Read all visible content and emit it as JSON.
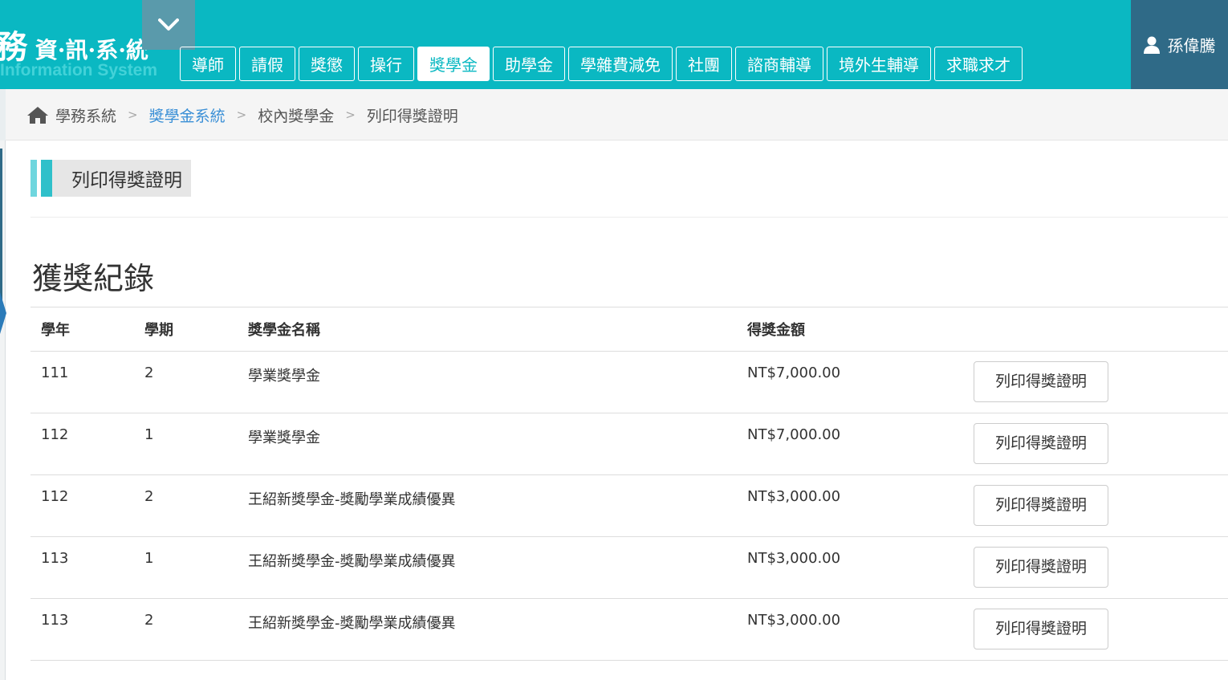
{
  "header": {
    "logo_main_big": "務",
    "logo_main_rest": " 資·訊·系·統",
    "logo_sub": "Information System",
    "nav": [
      {
        "label": "導師",
        "active": false
      },
      {
        "label": "請假",
        "active": false
      },
      {
        "label": "獎懲",
        "active": false
      },
      {
        "label": "操行",
        "active": false
      },
      {
        "label": "獎學金",
        "active": true
      },
      {
        "label": "助學金",
        "active": false
      },
      {
        "label": "學雜費減免",
        "active": false
      },
      {
        "label": "社團",
        "active": false
      },
      {
        "label": "諮商輔導",
        "active": false
      },
      {
        "label": "境外生輔導",
        "active": false
      },
      {
        "label": "求職求才",
        "active": false
      }
    ],
    "user_name": "孫偉騰",
    "icons": {
      "collapse": "chevron-down-icon",
      "user": "user-icon"
    }
  },
  "breadcrumb": {
    "items": [
      "學務系統",
      "獎學金系統",
      "校內獎學金",
      "列印得獎證明"
    ],
    "icons": {
      "home": "home-icon",
      "separator": "chevron-right-icon"
    }
  },
  "page": {
    "title": "列印得獎證明",
    "section_heading": "獲獎紀錄"
  },
  "table": {
    "headers": [
      "學年",
      "學期",
      "獎學金名稱",
      "得獎金額",
      ""
    ],
    "rows": [
      {
        "year": "111",
        "term": "2",
        "name": "學業獎學金",
        "amount": "NT$7,000.00",
        "action": "列印得獎證明"
      },
      {
        "year": "112",
        "term": "1",
        "name": "學業獎學金",
        "amount": "NT$7,000.00",
        "action": "列印得獎證明"
      },
      {
        "year": "112",
        "term": "2",
        "name": "王紹新獎學金-獎勵學業成績優異",
        "amount": "NT$3,000.00",
        "action": "列印得獎證明"
      },
      {
        "year": "113",
        "term": "1",
        "name": "王紹新獎學金-獎勵學業成績優異",
        "amount": "NT$3,000.00",
        "action": "列印得獎證明"
      },
      {
        "year": "113",
        "term": "2",
        "name": "王紹新獎學金-獎勵學業成績優異",
        "amount": "NT$3,000.00",
        "action": "列印得獎證明"
      }
    ]
  },
  "colors": {
    "header_bg": "#0ab8c2",
    "user_box_bg": "#2f6a87",
    "link": "#3a8fd6"
  }
}
